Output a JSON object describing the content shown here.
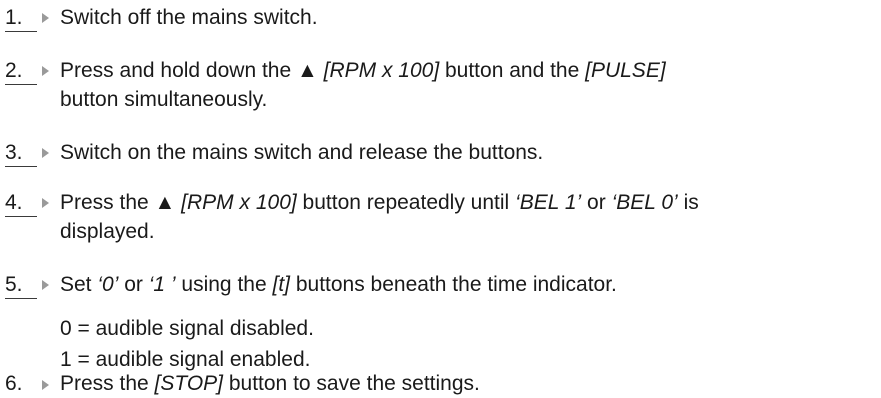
{
  "steps": [
    {
      "number": "1.",
      "lines": [
        [
          "Switch off the mains switch."
        ]
      ]
    },
    {
      "number": "2.",
      "lines": [
        [
          "Press and hold down the ▲ ",
          "[RPM x 100]",
          " button and the ",
          "[PULSE]"
        ],
        [
          "button simultaneously."
        ]
      ]
    },
    {
      "number": "3.",
      "lines": [
        [
          "Switch on the mains switch and release the buttons."
        ]
      ]
    },
    {
      "number": "4.",
      "lines": [
        [
          "Press the ▲ ",
          "[RPM x 100]",
          " button repeatedly until ",
          "‘BEL 1’",
          " or ",
          "‘BEL 0’",
          " is"
        ],
        [
          "displayed."
        ]
      ]
    },
    {
      "number": "5.",
      "lines": [
        [
          "Set ",
          "‘0’",
          " or ",
          "‘1 ’",
          " using the ",
          "[t]",
          " buttons beneath the time indicator."
        ]
      ]
    },
    {
      "number": "6.",
      "lines": [
        [
          "Press the ",
          "[STOP]",
          " button to save the settings."
        ]
      ]
    }
  ],
  "notes": [
    "0 = audible signal disabled.",
    "1 = audible signal enabled."
  ]
}
